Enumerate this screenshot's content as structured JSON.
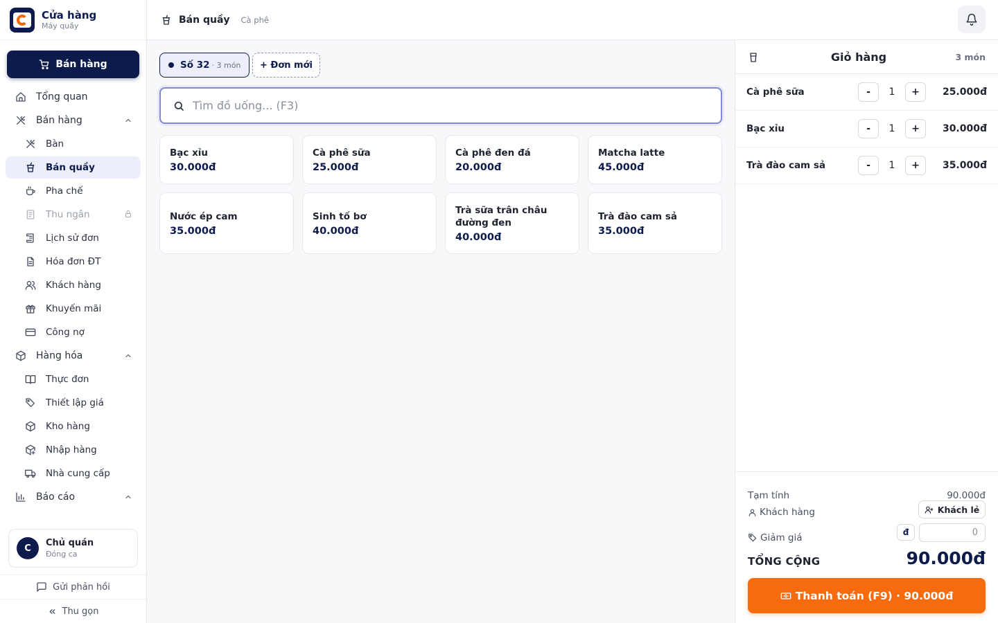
{
  "brand": {
    "title": "Cửa hàng",
    "subtitle": "Máy quầy"
  },
  "sell_button": "Bán hàng",
  "nav": {
    "overview": "Tổng quan",
    "sales_group": "Bán hàng",
    "tables": "Bàn",
    "counter": "Bán quầy",
    "bar": "Pha chế",
    "cashier": "Thu ngân",
    "order_history": "Lịch sử đơn",
    "einvoice": "Hóa đơn ĐT",
    "customers": "Khách hàng",
    "promotions": "Khuyến mãi",
    "debts": "Công nợ",
    "goods_group": "Hàng hóa",
    "menu": "Thực đơn",
    "pricing": "Thiết lập giá",
    "warehouse": "Kho hàng",
    "import": "Nhập hàng",
    "suppliers": "Nhà cung cấp",
    "reports_group": "Báo cáo"
  },
  "user": {
    "initial": "C",
    "name": "Chủ quán",
    "status": "Đóng ca"
  },
  "footer": {
    "feedback": "Gửi phản hồi",
    "collapse": "Thu gọn"
  },
  "topbar": {
    "title": "Bán quầy",
    "subtitle": "Cà phê"
  },
  "order_tab": {
    "name": "Số 32",
    "count": "· 3 món"
  },
  "new_order": "+ Đơn mới",
  "search": {
    "placeholder": "Tìm đồ uống... (F3)"
  },
  "products": [
    {
      "name": "Bạc xỉu",
      "price": "30.000đ"
    },
    {
      "name": "Cà phê sữa",
      "price": "25.000đ"
    },
    {
      "name": "Cà phê đen đá",
      "price": "20.000đ"
    },
    {
      "name": "Matcha latte",
      "price": "45.000đ"
    },
    {
      "name": "Nước ép cam",
      "price": "35.000đ"
    },
    {
      "name": "Sinh tố bơ",
      "price": "40.000đ"
    },
    {
      "name": "Trà sữa trân châu đường đen",
      "price": "40.000đ"
    },
    {
      "name": "Trà đào cam sả",
      "price": "35.000đ"
    }
  ],
  "cart": {
    "title": "Giỏ hàng",
    "count": "3 món",
    "items": [
      {
        "name": "Cà phê sữa",
        "qty": "1",
        "price": "25.000đ"
      },
      {
        "name": "Bạc xỉu",
        "qty": "1",
        "price": "30.000đ"
      },
      {
        "name": "Trà đào cam sả",
        "qty": "1",
        "price": "35.000đ"
      }
    ],
    "minus": "-",
    "plus": "+"
  },
  "summary": {
    "subtotal_label": "Tạm tính",
    "subtotal_value": "90.000đ",
    "customer_label": "Khách hàng",
    "customer_button": "Khách lẻ",
    "discount_label": "Giảm giá",
    "discount_currency": "đ",
    "discount_placeholder": "0",
    "total_label": "TỔNG CỘNG",
    "total_value": "90.000đ",
    "pay_button": "Thanh toán (F9) · 90.000đ"
  }
}
